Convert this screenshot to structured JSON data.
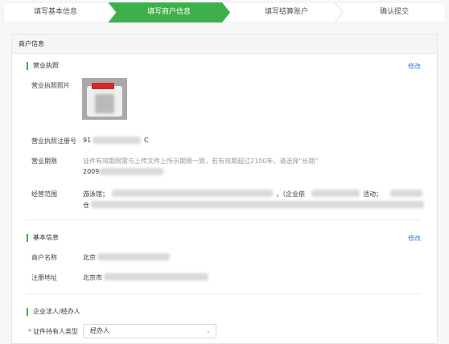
{
  "steps": [
    {
      "label": "填写基本信息",
      "active": false
    },
    {
      "label": "填写商户信息",
      "active": true
    },
    {
      "label": "填写结算账户",
      "active": false
    },
    {
      "label": "确认提交",
      "active": false
    }
  ],
  "colors": {
    "accent": "#3eb04a",
    "link": "#3c7be0",
    "required": "#e53935"
  },
  "card": {
    "title": "商户信息"
  },
  "license": {
    "title": "营业执照",
    "edit": "修改",
    "photo_label": "营业执照照片",
    "regno_label": "营业执照注册号",
    "regno_prefix": "91",
    "regno_suffix": "C",
    "period_label": "营业期限",
    "period_note": "证件有效期限需与上传文件上所示期限一致，若有效期超过2100年，请选择“长期”",
    "period_value": "2009",
    "scope_label": "经营范围",
    "scope_prefix": "游泳馆；",
    "scope_mid": "，（企业依",
    "scope_tail": "活动；",
    "scope_line2_prefix": "仓"
  },
  "basic": {
    "title": "基本信息",
    "edit": "修改",
    "name_label": "商户名称",
    "name_value": "北京",
    "address_label": "注册地址",
    "address_value": "北京市"
  },
  "legal": {
    "title": "企业法人/经办人",
    "holder_type_label": "证件持有人类型",
    "holder_type_value": "经办人",
    "caret": "⌄"
  }
}
